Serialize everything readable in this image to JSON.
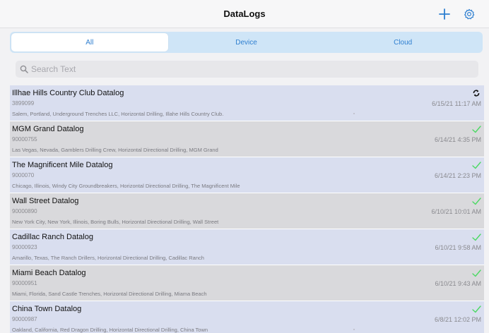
{
  "header": {
    "title": "DataLogs",
    "add_icon": "plus-icon",
    "settings_icon": "gear-icon"
  },
  "tabs": [
    {
      "label": "All",
      "active": true
    },
    {
      "label": "Device",
      "active": false
    },
    {
      "label": "Cloud",
      "active": false
    }
  ],
  "search": {
    "placeholder": "Search Text",
    "value": ""
  },
  "colors": {
    "accent": "#2f7fd0",
    "check": "#4cd964",
    "row_alt_blue": "#d9deef",
    "row_alt_gray": "#d9d9dc"
  },
  "datalogs": [
    {
      "title": "Illhae Hills Country Club Datalog",
      "id": "3899099",
      "description": "Salem, Portland, Underground Trenches LLC, Horizontal Drilling, Illahe Hills Country Club.",
      "date": "6/15/21 11:17 AM",
      "status": "syncing"
    },
    {
      "title": "MGM Grand Datalog",
      "id": "90000755",
      "description": "Las Vegas, Nevada, Gamblers Drilling Crew, Horizontal Directional Drilling, MGM Grand",
      "date": "6/14/21 4:35 PM",
      "status": "synced"
    },
    {
      "title": "The Magnificent Mile Datalog",
      "id": "9000070",
      "description": "Chicago, Illinois, Windy City Groundbreakers, Horizontal Directional Drilling, The Magnificent Mile",
      "date": "6/14/21 2:23 PM",
      "status": "synced"
    },
    {
      "title": "Wall Street Datalog",
      "id": "90000890",
      "description": "New York City, New York, Illinois, Boring Bulls, Horizontal Directional Drilling, Wall Street",
      "date": "6/10/21 10:01 AM",
      "status": "synced"
    },
    {
      "title": "Cadillac Ranch Datalog",
      "id": "90000923",
      "description": "Amarillo, Texas, The Ranch Drillers, Horizontal Directional Drilling, Cadillac Ranch",
      "date": "6/10/21 9:58 AM",
      "status": "synced"
    },
    {
      "title": "Miami Beach Datalog",
      "id": "90000951",
      "description": "Miami, Florida, Sand Castle Trenches, Horizontal Directional Drilling, Miama Beach",
      "date": "6/10/21 9:43 AM",
      "status": "synced"
    },
    {
      "title": "China Town Datalog",
      "id": "90000987",
      "description": "Oakland, California, Red Dragon Drilling, Horizontal Directional Drilling, China Town",
      "date": "6/8/21 12:02 PM",
      "status": "synced"
    }
  ]
}
